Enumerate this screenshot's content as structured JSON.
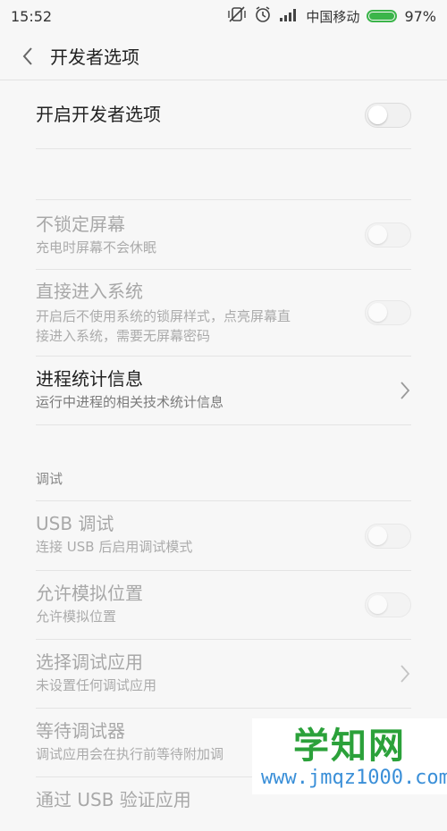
{
  "status_bar": {
    "time": "15:52",
    "carrier": "中国移动",
    "battery_percent": "97%",
    "battery_level": 0.97,
    "icons": [
      "vibrate-off-icon",
      "alarm-icon",
      "signal-icon",
      "battery-icon"
    ]
  },
  "header": {
    "title": "开发者选项",
    "back_icon": "chevron-left-icon"
  },
  "settings": {
    "developer_options": {
      "title": "开启开发者选项",
      "enabled": false
    },
    "stay_awake": {
      "title": "不锁定屏幕",
      "subtitle": "充电时屏幕不会休眠",
      "enabled": false
    },
    "direct_enter": {
      "title": "直接进入系统",
      "subtitle_line1": "开启后不使用系统的锁屏样式，点亮屏幕直",
      "subtitle_line2": "接进入系统，需要无屏幕密码",
      "enabled": false
    },
    "process_stats": {
      "title": "进程统计信息",
      "subtitle": "运行中进程的相关技术统计信息"
    },
    "debug_section": "调试",
    "usb_debug": {
      "title": "USB 调试",
      "subtitle": "连接 USB 后启用调试模式",
      "enabled": false
    },
    "mock_location": {
      "title": "允许模拟位置",
      "subtitle": "允许模拟位置",
      "enabled": false
    },
    "debug_app": {
      "title": "选择调试应用",
      "subtitle": "未设置任何调试应用"
    },
    "wait_debugger": {
      "title": "等待调试器",
      "subtitle": "调试应用会在执行前等待附加调"
    },
    "verify_usb": {
      "title": "通过 USB 验证应用"
    }
  },
  "watermark": {
    "main": "学知网",
    "url": "www.jmqz1000.com"
  },
  "colors": {
    "accent": "#3bb54a",
    "disabled_text": "#a8a8a8",
    "watermark_green": "#2ba13a",
    "watermark_blue": "#3a8fd8"
  }
}
